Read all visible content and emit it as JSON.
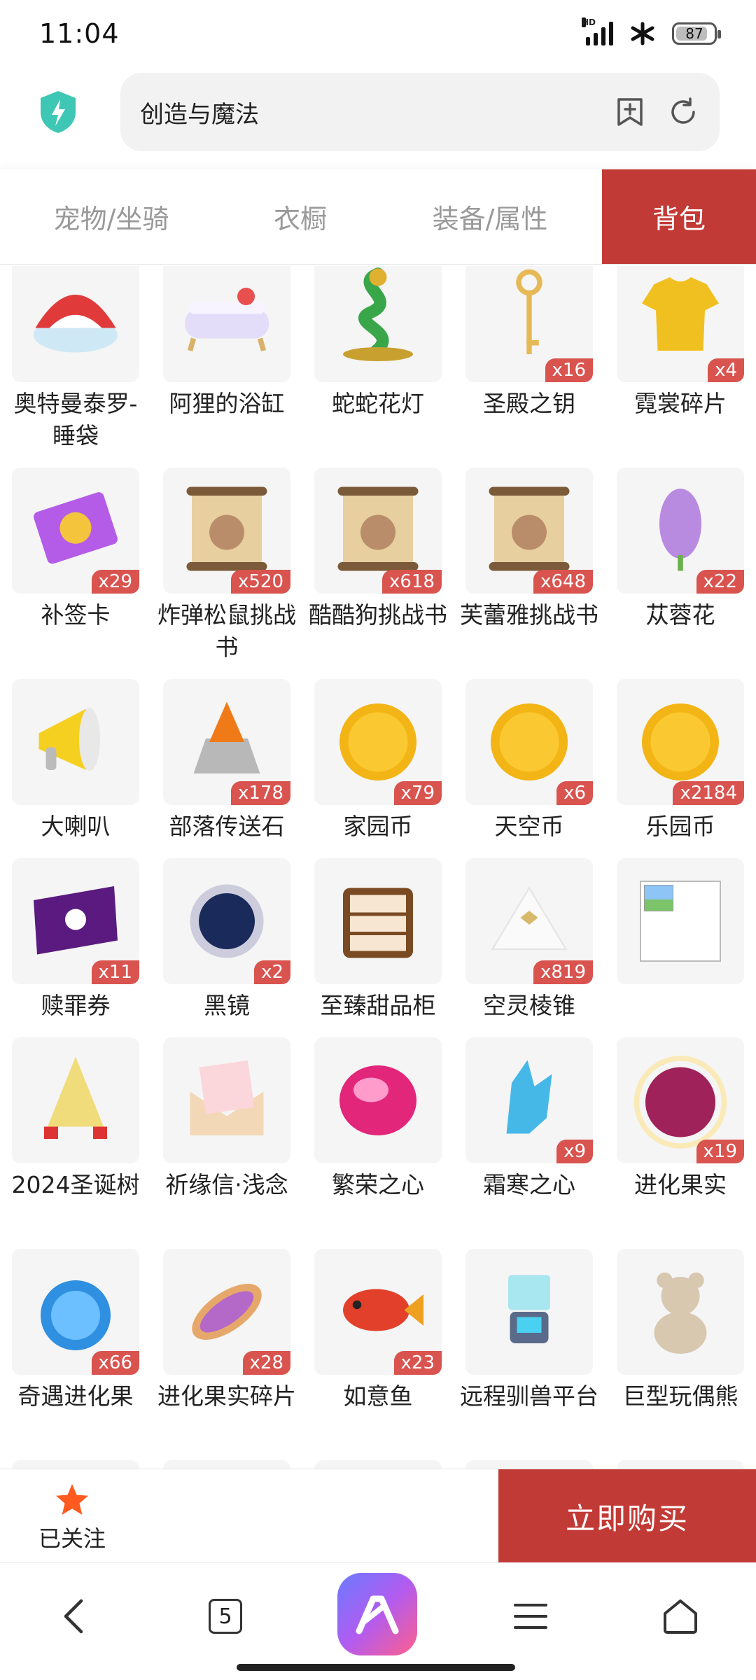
{
  "status_bar": {
    "time": "11:04",
    "network": "HD",
    "battery": "87"
  },
  "address_bar": {
    "title": "创造与魔法",
    "icons": [
      "shield-icon",
      "add-bookmark-icon",
      "refresh-icon"
    ]
  },
  "tabs": [
    {
      "label": "宠物/坐骑",
      "active": false
    },
    {
      "label": "衣橱",
      "active": false
    },
    {
      "label": "装备/属性",
      "active": false
    },
    {
      "label": "背包",
      "active": true
    }
  ],
  "items": [
    {
      "name": "奥特曼泰罗-睡袋",
      "qty": "",
      "icon": "sleeping-bag-icon"
    },
    {
      "name": "阿狸的浴缸",
      "qty": "",
      "icon": "bathtub-icon"
    },
    {
      "name": "蛇蛇花灯",
      "qty": "",
      "icon": "dragon-lantern-icon"
    },
    {
      "name": "圣殿之钥",
      "qty": "x16",
      "icon": "key-icon"
    },
    {
      "name": "霓裳碎片",
      "qty": "x4",
      "icon": "shirt-icon"
    },
    {
      "name": "补签卡",
      "qty": "x29",
      "icon": "ticket-icon"
    },
    {
      "name": "炸弹松鼠挑战书",
      "qty": "x520",
      "icon": "wanted-scroll-icon"
    },
    {
      "name": "酷酷狗挑战书",
      "qty": "x618",
      "icon": "wanted-scroll-icon"
    },
    {
      "name": "芙蕾雅挑战书",
      "qty": "x648",
      "icon": "wanted-scroll-icon"
    },
    {
      "name": "苁蓉花",
      "qty": "x22",
      "icon": "flower-icon"
    },
    {
      "name": "大喇叭",
      "qty": "",
      "icon": "megaphone-icon"
    },
    {
      "name": "部落传送石",
      "qty": "x178",
      "icon": "teleport-stone-icon"
    },
    {
      "name": "家园币",
      "qty": "x79",
      "icon": "coin-icon"
    },
    {
      "name": "天空币",
      "qty": "x6",
      "icon": "coin-icon"
    },
    {
      "name": "乐园币",
      "qty": "x2184",
      "icon": "coin-icon"
    },
    {
      "name": "赎罪券",
      "qty": "x11",
      "icon": "purple-ticket-icon"
    },
    {
      "name": "黑镜",
      "qty": "x2",
      "icon": "black-mirror-icon"
    },
    {
      "name": "至臻甜品柜",
      "qty": "",
      "icon": "dessert-cabinet-icon"
    },
    {
      "name": "空灵棱锥",
      "qty": "x819",
      "icon": "pyramid-icon"
    },
    {
      "name": "",
      "qty": "",
      "icon": "broken-image-icon"
    },
    {
      "name": "2024圣诞树",
      "qty": "",
      "icon": "christmas-tree-icon"
    },
    {
      "name": "祈缘信·浅念",
      "qty": "",
      "icon": "envelope-icon"
    },
    {
      "name": "繁荣之心",
      "qty": "",
      "icon": "pink-gem-icon"
    },
    {
      "name": "霜寒之心",
      "qty": "x9",
      "icon": "ice-crystal-icon"
    },
    {
      "name": "进化果实",
      "qty": "x19",
      "icon": "berry-icon"
    },
    {
      "name": "奇遇进化果",
      "qty": "x66",
      "icon": "blue-berry-icon"
    },
    {
      "name": "进化果实碎片",
      "qty": "x28",
      "icon": "fruit-slice-icon"
    },
    {
      "name": "如意鱼",
      "qty": "x23",
      "icon": "fish-icon"
    },
    {
      "name": "远程驯兽平台",
      "qty": "",
      "icon": "platform-icon"
    },
    {
      "name": "巨型玩偶熊",
      "qty": "",
      "icon": "teddy-bear-icon"
    }
  ],
  "action_bar": {
    "follow_label": "已关注",
    "buy_label": "立即购买"
  },
  "nav": {
    "tab_count": "5"
  }
}
